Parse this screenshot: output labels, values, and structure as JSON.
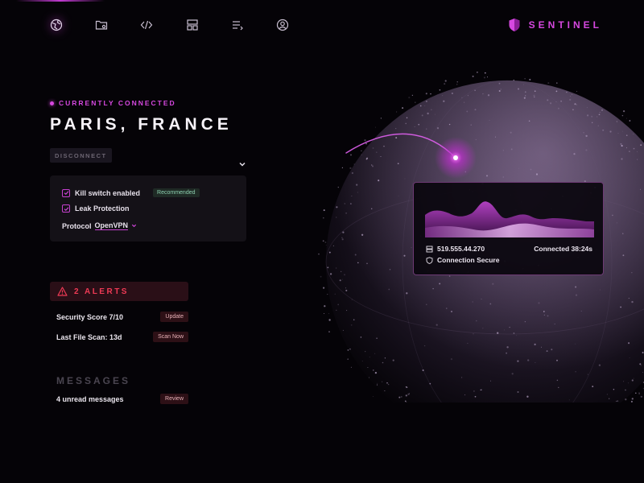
{
  "nav": {
    "items": [
      {
        "icon": "globe-icon"
      },
      {
        "icon": "folder-settings-icon"
      },
      {
        "icon": "code-icon"
      },
      {
        "icon": "layout-icon"
      },
      {
        "icon": "list-arrow-icon"
      },
      {
        "icon": "user-circle-icon"
      }
    ],
    "active_index": 0
  },
  "brand": {
    "name": "SENTINEL",
    "icon": "shield-icon"
  },
  "connection": {
    "status": "CURRENTLY CONNECTED",
    "location": "PARIS, FRANCE",
    "disconnect_label": "DISCONNECT"
  },
  "options": {
    "kill_switch": {
      "label": "Kill switch enabled",
      "checked": true,
      "badge": "Recommended"
    },
    "leak_protection": {
      "label": "Leak Protection",
      "checked": true
    },
    "protocol": {
      "label": "Protocol",
      "value": "OpenVPN"
    }
  },
  "alerts": {
    "label": "2 ALERTS",
    "items": [
      {
        "text": "Security Score 7/10",
        "action": "Update"
      },
      {
        "text": "Last File Scan: 13d",
        "action": "Scan Now"
      }
    ]
  },
  "messages": {
    "heading": "MESSAGES",
    "text": "4 unread messages",
    "action": "Review"
  },
  "card": {
    "ip": "519.555.44.270",
    "connected": "Connected 38:24s",
    "secure": "Connection Secure"
  },
  "colors": {
    "accent": "#d648e0",
    "alert": "#ef3a55",
    "background": "#050307",
    "badge_green": "#8dd0b0"
  }
}
